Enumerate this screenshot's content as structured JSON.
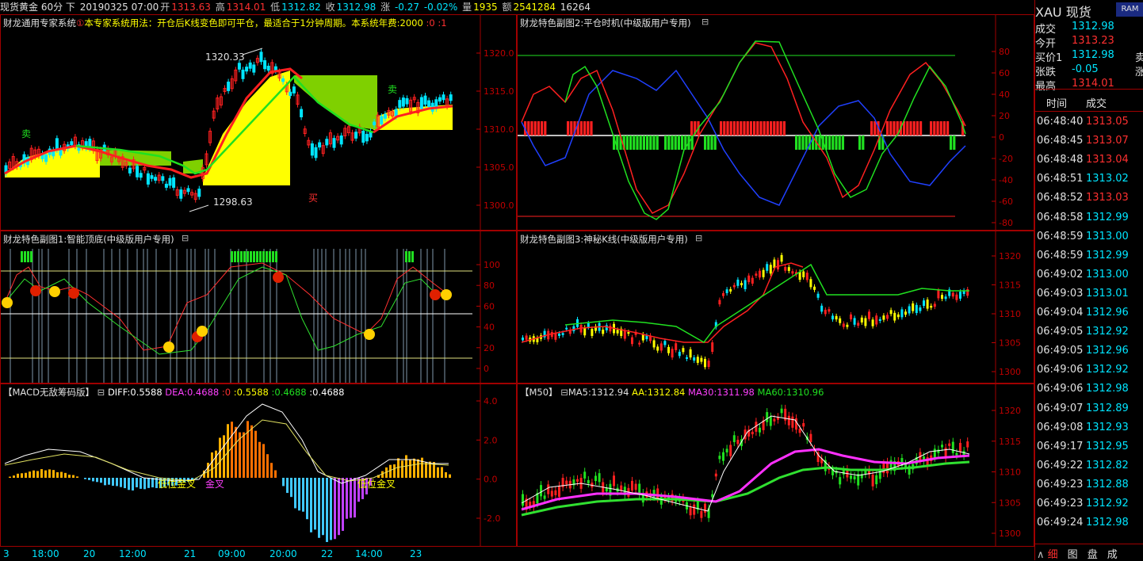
{
  "topbar": {
    "symbol": "现货黄金 60分 下",
    "date": "20190325 07:00",
    "open_label": "开",
    "open": "1313.63",
    "high_label": "高",
    "high": "1314.01",
    "low_label": "低",
    "low": "1312.82",
    "close_label": "收",
    "close": "1312.98",
    "change_label": "涨",
    "change": "-0.27",
    "change_pct": "-0.02%",
    "vol_label": "量",
    "vol": "1935",
    "amt_label": "额",
    "amt": "2541284",
    "extra": "16264"
  },
  "panel_main": {
    "title_prefix": "财龙通用专家系统",
    "title_note": "本专家系统用法：开仓后K线变色即可平仓，最适合于1分钟周期。本系统年费:2000",
    "title_suffix": ":0 :1",
    "high_mark": "1320.33",
    "low_mark": "1298.63",
    "sell1": "卖",
    "sell2": "卖",
    "buy": "买",
    "axis": [
      "1320.0",
      "1315.0",
      "1310.0",
      "1305.0",
      "1300.0"
    ]
  },
  "panel_sub2": {
    "title": "财龙特色副图2:平仓时机(中级版用户专用)",
    "axis": [
      "80",
      "60",
      "40",
      "20",
      "0",
      "-20",
      "-40",
      "-60",
      "-80"
    ]
  },
  "panel_sub1": {
    "title": "财龙特色副图1:智能顶底(中级版用户专用)",
    "axis": [
      "100",
      "80",
      "60",
      "40",
      "20",
      "0"
    ]
  },
  "panel_sub3": {
    "title": "财龙特色副图3:神秘K线(中级版用户专用)",
    "axis": [
      "1320",
      "1315",
      "1310",
      "1305",
      "1300"
    ]
  },
  "panel_macd": {
    "name": "【MACD无敌筹码版】",
    "diff": "DIFF:0.5588",
    "dea": "DEA:0.4688",
    "v0": ":0",
    "v1": ":0.5588",
    "v2": ":0.4688",
    "v3": ":0.4688",
    "gold1": "低位金叉",
    "gold2": "金叉",
    "gold3": "低位金叉",
    "axis": [
      "4.0",
      "2.0",
      "0.0",
      "-2.0"
    ]
  },
  "panel_ma": {
    "name": "【M50】",
    "ma5": "MA5:1312.94",
    "aa": "AA:1312.84",
    "ma30": "MA30:1311.98",
    "ma60": "MA60:1310.96",
    "axis": [
      "1320",
      "1315",
      "1310",
      "1305",
      "1300"
    ]
  },
  "xaxis": [
    "3",
    "18:00",
    "20",
    "12:00",
    "21",
    "09:00",
    "20:00",
    "22",
    "14:00",
    "23"
  ],
  "right_panel": {
    "symbol": "XAU",
    "type": "现货",
    "badge": "RAM",
    "quotes": [
      {
        "label": "成交",
        "value": "1312.98",
        "color": "#00e5ff",
        "side": ""
      },
      {
        "label": "今开",
        "value": "1313.23",
        "color": "#ff3030",
        "side": ""
      },
      {
        "label": "买价1",
        "value": "1312.98",
        "color": "#00e5ff",
        "side": "卖"
      },
      {
        "label": "张跌",
        "value": "-0.05",
        "color": "#00e5ff",
        "side": "涨"
      },
      {
        "label": "最高",
        "value": "1314.01",
        "color": "#ff3030",
        "side": ""
      }
    ],
    "col_time": "时间",
    "col_price": "成交",
    "ticks": [
      {
        "t": "06:48:40",
        "p": "1313.05",
        "up": true
      },
      {
        "t": "06:48:45",
        "p": "1313.07",
        "up": true
      },
      {
        "t": "06:48:48",
        "p": "1313.04",
        "up": true
      },
      {
        "t": "06:48:51",
        "p": "1313.02",
        "up": false
      },
      {
        "t": "06:48:52",
        "p": "1313.03",
        "up": true
      },
      {
        "t": "06:48:58",
        "p": "1312.99",
        "up": false
      },
      {
        "t": "06:48:59",
        "p": "1313.00",
        "up": false
      },
      {
        "t": "06:48:59",
        "p": "1312.99",
        "up": false
      },
      {
        "t": "06:49:02",
        "p": "1313.00",
        "up": false
      },
      {
        "t": "06:49:03",
        "p": "1313.01",
        "up": false
      },
      {
        "t": "06:49:04",
        "p": "1312.96",
        "up": false
      },
      {
        "t": "06:49:05",
        "p": "1312.92",
        "up": false
      },
      {
        "t": "06:49:05",
        "p": "1312.96",
        "up": false
      },
      {
        "t": "06:49:06",
        "p": "1312.92",
        "up": false
      },
      {
        "t": "06:49:06",
        "p": "1312.98",
        "up": false
      },
      {
        "t": "06:49:07",
        "p": "1312.89",
        "up": false
      },
      {
        "t": "06:49:08",
        "p": "1312.93",
        "up": false
      },
      {
        "t": "06:49:17",
        "p": "1312.95",
        "up": false
      },
      {
        "t": "06:49:22",
        "p": "1312.82",
        "up": false
      },
      {
        "t": "06:49:23",
        "p": "1312.88",
        "up": false
      },
      {
        "t": "06:49:23",
        "p": "1312.92",
        "up": false
      },
      {
        "t": "06:49:24",
        "p": "1312.98",
        "up": false
      }
    ],
    "tabs": [
      "细",
      "图",
      "盘",
      "成"
    ]
  }
}
